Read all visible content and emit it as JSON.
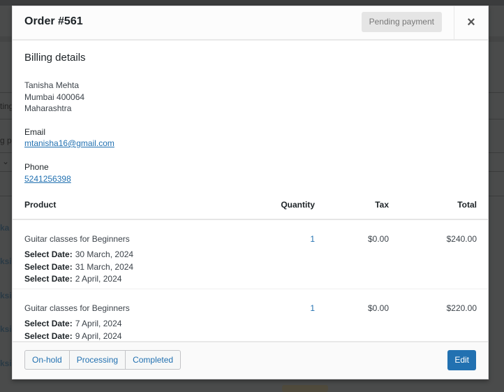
{
  "background": {
    "fragments": [
      "ting",
      "g p",
      "⌄",
      "ka",
      "ksi",
      "ksi",
      "ksi",
      "ksi"
    ]
  },
  "modal": {
    "title": "Order #561",
    "status": "Pending payment",
    "close_icon": "×",
    "billing": {
      "heading": "Billing details",
      "address": [
        "Tanisha Mehta",
        "Mumbai 400064",
        "Maharashtra"
      ],
      "email_label": "Email",
      "email": "mtanisha16@gmail.com",
      "phone_label": "Phone",
      "phone": "5241256398"
    },
    "table": {
      "headers": {
        "product": "Product",
        "quantity": "Quantity",
        "tax": "Tax",
        "total": "Total"
      },
      "items": [
        {
          "name": "Guitar classes for Beginners",
          "meta": [
            {
              "key": "Select Date:",
              "value": "30 March, 2024"
            },
            {
              "key": "Select Date:",
              "value": "31 March, 2024"
            },
            {
              "key": "Select Date:",
              "value": "2 April, 2024"
            }
          ],
          "quantity": "1",
          "tax": "$0.00",
          "total": "$240.00"
        },
        {
          "name": "Guitar classes for Beginners",
          "meta": [
            {
              "key": "Select Date:",
              "value": "7 April, 2024"
            },
            {
              "key": "Select Date:",
              "value": "9 April, 2024"
            }
          ],
          "quantity": "1",
          "tax": "$0.00",
          "total": "$220.00"
        }
      ]
    },
    "footer": {
      "status_buttons": [
        "On-hold",
        "Processing",
        "Completed"
      ],
      "edit_label": "Edit"
    }
  },
  "colors": {
    "accent": "#2271b1",
    "backdrop": "#4a4b4b",
    "badge_bg": "#e5e5e5"
  }
}
